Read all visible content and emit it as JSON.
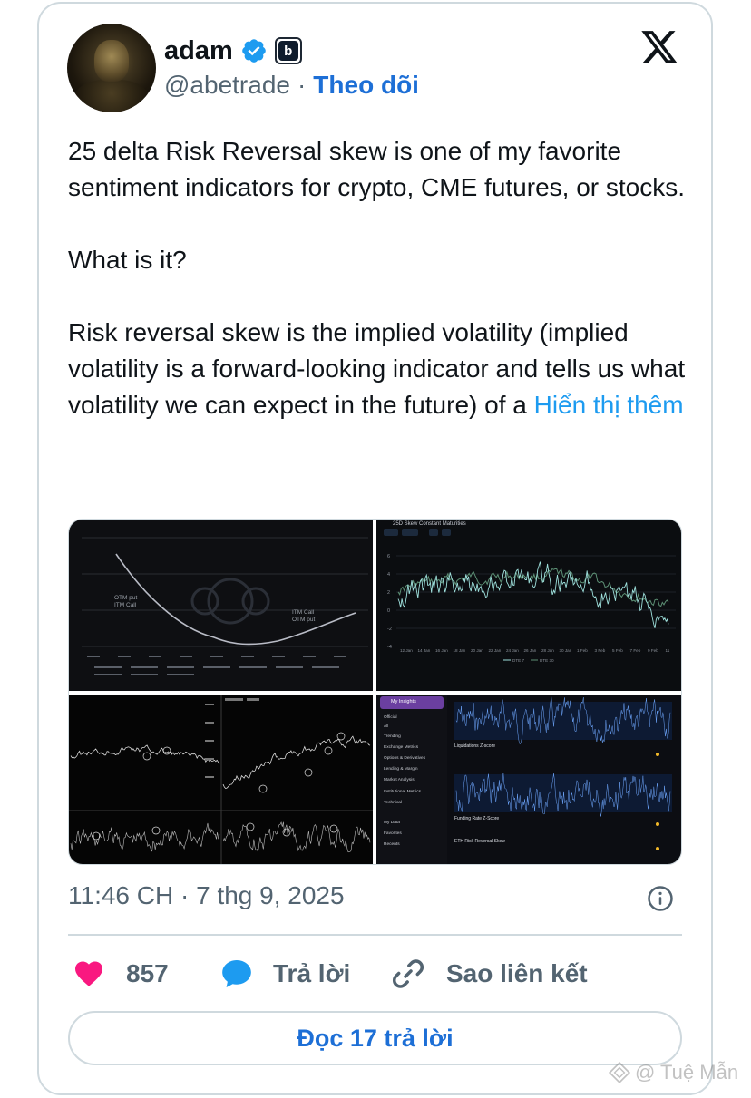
{
  "author": {
    "name": "adam",
    "handle": "@abetrade",
    "separator": "·",
    "follow_label": "Theo dõi",
    "affiliate_badge": "b"
  },
  "tweet": {
    "paragraphs": [
      "25 delta Risk Reversal skew is one of my favorite sentiment indicators for crypto, CME futures, or stocks.",
      "What is it?",
      "Risk reversal skew is the implied volatility (implied volatility is a forward-looking indicator and tells us what volatility we can expect in the future) of a"
    ],
    "show_more_label": "Hiển thị thêm"
  },
  "media": {
    "panel1": {
      "left_label_1": "OTM put",
      "left_label_2": "ITM Call",
      "right_label_1": "ITM Call",
      "right_label_2": "OTM put"
    },
    "panel2": {
      "title": "25D Skew Constant Maturities",
      "x_ticks": [
        "12 Jan",
        "14 Jan",
        "16 Jan",
        "18 Jan",
        "20 Jan",
        "22 Jan",
        "24 Jan",
        "26 Jan",
        "28 Jan",
        "30 Jan",
        "1 Feb",
        "3 Feb",
        "5 Feb",
        "7 Feb",
        "9 Feb",
        "11"
      ],
      "y_ticks": [
        "6",
        "4",
        "2",
        "0",
        "-2",
        "-4"
      ],
      "legend": [
        "DTE 7",
        "DTE 30"
      ]
    },
    "panel4": {
      "brand": "My Insights",
      "menu": [
        "Official",
        "All",
        "Trending",
        "Exchange Metrics",
        "Options & Derivatives",
        "Lending & Margin",
        "Market Analysis",
        "Institutional Metrics",
        "Technical",
        "My Data",
        "Favorites",
        "Recents"
      ],
      "cards": [
        "Liquidations Z-score",
        "Funding Rate Z-Score",
        "ETH Risk Reversal Skew"
      ]
    }
  },
  "timestamp": "11:46 CH · 7 thg 9, 2025",
  "actions": {
    "likes_count": "857",
    "reply_label": "Trả lời",
    "copy_link_label": "Sao liên kết"
  },
  "read_replies_label": "Đọc 17 trả lời",
  "watermark": "@ Tuệ Mẫn",
  "colors": {
    "like": "#f91880",
    "reply": "#1d9bf0",
    "link": "#1d6fd6",
    "muted": "#536471",
    "verified": "#1d9bf0"
  },
  "icons": [
    "verified-badge-icon",
    "x-logo-icon",
    "info-icon",
    "heart-icon",
    "reply-bubble-icon",
    "link-icon"
  ]
}
